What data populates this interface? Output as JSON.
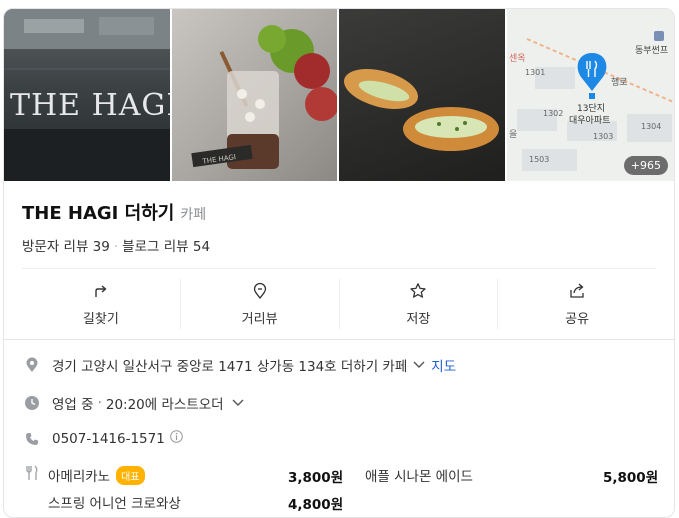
{
  "photos": {
    "storefront_sign": "THE HAGI",
    "cup_label": "THE HAGI",
    "more_count": "+965",
    "map": {
      "labels": [
        "동부썬프",
        "1301",
        "1302",
        "1303",
        "1304",
        "1503",
        "13단지",
        "대우아파트",
        "행로",
        "센옥",
        "을"
      ]
    }
  },
  "place": {
    "name": "THE HAGI 더하기",
    "category": "카페",
    "visitor_reviews": "방문자 리뷰 39",
    "blog_reviews": "블로그 리뷰 54"
  },
  "actions": [
    {
      "label": "길찾기",
      "icon": "directions-icon"
    },
    {
      "label": "거리뷰",
      "icon": "street-view-icon"
    },
    {
      "label": "저장",
      "icon": "star-icon"
    },
    {
      "label": "공유",
      "icon": "share-icon"
    }
  ],
  "info": {
    "address": "경기 고양시 일산서구 중앙로 1471 상가동 134호 더하기 카페",
    "map_link": "지도",
    "status": "영업 중",
    "last_order": "20:20에 라스트오더",
    "phone": "0507-1416-1571"
  },
  "menu": [
    {
      "name": "아메리카노",
      "badge": "대표",
      "price": "3,800원"
    },
    {
      "name": "애플 시나몬 에이드",
      "price": "5,800원"
    },
    {
      "name": "스프링 어니언 크로와상",
      "price": "4,800원"
    }
  ],
  "colors": {
    "accent_blue": "#1f5fd4",
    "badge_orange": "#ffb300",
    "map_pin": "#1e88e5"
  }
}
